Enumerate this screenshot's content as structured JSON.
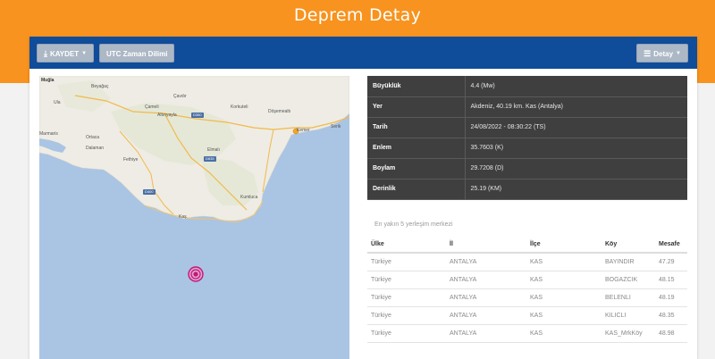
{
  "page_title": "Deprem Detay",
  "toolbar": {
    "save_label": "KAYDET",
    "utc_label": "UTC Zaman Dilimi",
    "detail_label": "Detay"
  },
  "map": {
    "places": [
      "Muğla",
      "Beyağaç",
      "Çavdır",
      "Ula",
      "Çameli",
      "Korkuteli",
      "Döşemealtı",
      "Altınyayla",
      "Kemer",
      "Marmaris",
      "Ortaca",
      "Elmalı",
      "Serik",
      "Dalaman",
      "Fethiye",
      "Kaş",
      "Kumluca"
    ],
    "roads": [
      "D350",
      "D635",
      "D400"
    ]
  },
  "details": [
    {
      "label": "Büyüklük",
      "value": "4.4 (Mw)"
    },
    {
      "label": "Yer",
      "value": "Akdeniz, 40.19 km. Kas (Antalya)"
    },
    {
      "label": "Tarih",
      "value": "24/08/2022 - 08:30:22 (TS)"
    },
    {
      "label": "Enlem",
      "value": "35.7603 (K)"
    },
    {
      "label": "Boylam",
      "value": "29.7208 (D)"
    },
    {
      "label": "Derinlik",
      "value": "25.19 (KM)"
    }
  ],
  "settlements": {
    "caption": "En yakın 5 yerleşim merkezi",
    "headers": [
      "Ülke",
      "İl",
      "İlçe",
      "Köy",
      "Mesafe"
    ],
    "rows": [
      [
        "Türkiye",
        "ANTALYA",
        "KAS",
        "BAYINDIR",
        "47.29"
      ],
      [
        "Türkiye",
        "ANTALYA",
        "KAS",
        "BOGAZCIK",
        "48.15"
      ],
      [
        "Türkiye",
        "ANTALYA",
        "KAS",
        "BELENLI",
        "48.19"
      ],
      [
        "Türkiye",
        "ANTALYA",
        "KAS",
        "KILICLI",
        "48.35"
      ],
      [
        "Türkiye",
        "ANTALYA",
        "KAS",
        "KAS_MrkKöy",
        "48.98"
      ]
    ]
  },
  "colors": {
    "header_orange": "#f7931e",
    "toolbar_blue": "#0f4c9a",
    "epicenter_marker": "#c2187a",
    "sea": "#aac4e4",
    "land": "#eeece4"
  }
}
